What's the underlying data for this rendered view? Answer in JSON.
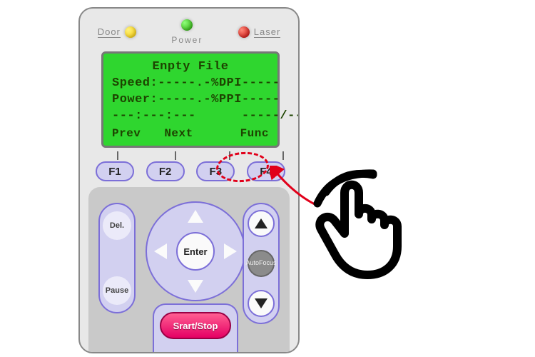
{
  "leds": {
    "door": "Door",
    "power": "Power",
    "laser": "Laser"
  },
  "lcd": {
    "title": "Enpty File",
    "line_speed": "Speed:-----.-%DPI-----",
    "line_power": "Power:-----.-%PPI-----",
    "line_time": "---:---:---      -----/-----",
    "prev": "Prev",
    "next": "Next",
    "func": "Func"
  },
  "fkeys": {
    "f1": "F1",
    "f2": "F2",
    "f3": "F3",
    "f4": "F4"
  },
  "left": {
    "del": "Del.",
    "pause": "Pause"
  },
  "right": {
    "autofocus_l1": "Auto",
    "autofocus_l2": "Focus"
  },
  "center": {
    "enter": "Enter"
  },
  "startstop": "Srart/Stop",
  "colors": {
    "lcd_bg": "#2fd62f",
    "accent": "#7c6fd8",
    "danger": "#e50064",
    "highlight": "#e1001a"
  }
}
